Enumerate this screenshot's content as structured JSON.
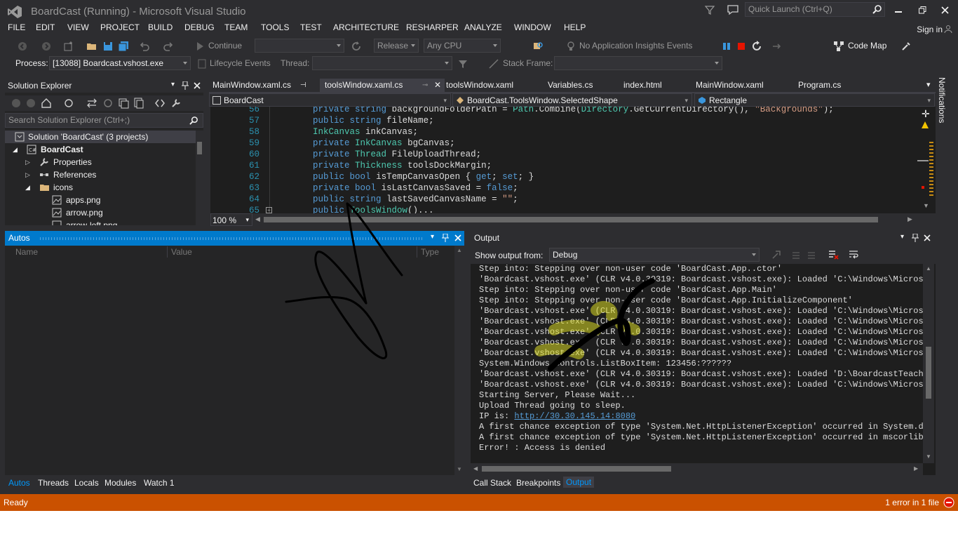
{
  "window": {
    "title": "BoardCast (Running) - Microsoft Visual Studio",
    "quick_launch": "Quick Launch (Ctrl+Q)",
    "sign_in": "Sign in"
  },
  "menu": [
    "FILE",
    "EDIT",
    "VIEW",
    "PROJECT",
    "BUILD",
    "DEBUG",
    "TEAM",
    "TOOLS",
    "TEST",
    "ARCHITECTURE",
    "RESHARPER",
    "ANALYZE",
    "WINDOW",
    "HELP"
  ],
  "toolbar": {
    "continue_label": "Continue",
    "config": "Release",
    "platform": "Any CPU",
    "insights": "No Application Insights Events",
    "code_map": "Code Map"
  },
  "debug_bar": {
    "process_label": "Process:",
    "process_value": "[13088] Boardcast.vshost.exe",
    "lifecycle": "Lifecycle Events",
    "thread_label": "Thread:",
    "stack_frame_label": "Stack Frame:"
  },
  "solution_explorer": {
    "title": "Solution Explorer",
    "search_placeholder": "Search Solution Explorer (Ctrl+;)",
    "items": [
      {
        "label": "Solution 'BoardCast' (3 projects)"
      },
      {
        "label": "BoardCast"
      },
      {
        "label": "Properties"
      },
      {
        "label": "References"
      },
      {
        "label": "icons"
      },
      {
        "label": "apps.png"
      },
      {
        "label": "arrow.png"
      },
      {
        "label": "arrow-left.png"
      }
    ]
  },
  "editor": {
    "tabs": [
      "MainWindow.xaml.cs",
      "toolsWindow.xaml.cs",
      "toolsWindow.xaml",
      "Variables.cs",
      "index.html",
      "MainWindow.xaml",
      "Program.cs"
    ],
    "active_tab": "toolsWindow.xaml.cs",
    "nav_project": "BoardCast",
    "nav_member": "BoardCast.ToolsWindow.SelectedShape",
    "nav_shape": "Rectangle",
    "zoom": "100 %",
    "lines": [
      {
        "n": "56",
        "code": "private string backgroundFolderPath = Path.Combine(Directory.GetCurrentDirectory(), \"Backgrounds\");"
      },
      {
        "n": "57",
        "code": "public string fileName;"
      },
      {
        "n": "58",
        "code": "InkCanvas inkCanvas;"
      },
      {
        "n": "59",
        "code": "private InkCanvas bgCanvas;"
      },
      {
        "n": "60",
        "code": "private Thread FileUploadThread;"
      },
      {
        "n": "61",
        "code": "private Thickness toolsDockMargin;"
      },
      {
        "n": "62",
        "code": "public bool isTempCanvasOpen { get; set; }"
      },
      {
        "n": "63",
        "code": "private bool isLastCanvasSaved = false;"
      },
      {
        "n": "64",
        "code": "public string lastSavedCanvasName = \"\";"
      },
      {
        "n": "65",
        "code": "public ToolsWindow()..."
      }
    ]
  },
  "autos": {
    "title": "Autos",
    "columns": [
      "Name",
      "Value",
      "Type"
    ],
    "tabs": [
      "Autos",
      "Threads",
      "Locals",
      "Modules",
      "Watch 1"
    ]
  },
  "output": {
    "title": "Output",
    "show_from_label": "Show output from:",
    "show_from_value": "Debug",
    "lines": [
      "Step into: Stepping over non-user code 'BoardCast.App..ctor'",
      "'Boardcast.vshost.exe' (CLR v4.0.30319: Boardcast.vshost.exe): Loaded 'C:\\Windows\\Microsoft",
      "Step into: Stepping over non-user code 'BoardCast.App.Main'",
      "Step into: Stepping over non-user code 'BoardCast.App.InitializeComponent'",
      "'Boardcast.vshost.exe' (CLR v4.0.30319: Boardcast.vshost.exe): Loaded 'C:\\Windows\\Microsoft",
      "'Boardcast.vshost.exe' (CLR v4.0.30319: Boardcast.vshost.exe): Loaded 'C:\\Windows\\Microsoft",
      "'Boardcast.vshost.exe' (CLR v4.0.30319: Boardcast.vshost.exe): Loaded 'C:\\Windows\\Microsoft",
      "'Boardcast.vshost.exe' (CLR v4.0.30319: Boardcast.vshost.exe): Loaded 'C:\\Windows\\Microsoft",
      "'Boardcast.vshost.exe' (CLR v4.0.30319: Boardcast.vshost.exe): Loaded 'C:\\Windows\\Microsoft",
      "System.Windows.Controls.ListBoxItem: 123456:??????",
      "'Boardcast.vshost.exe' (CLR v4.0.30319: Boardcast.vshost.exe): Loaded 'D:\\BoardcastTeacher\\",
      "'Boardcast.vshost.exe' (CLR v4.0.30319: Boardcast.vshost.exe): Loaded 'C:\\Windows\\Microsoft",
      "Starting Server, Please Wait...",
      "Upload Thread going to sleep.",
      "A first chance exception of type 'System.Net.HttpListenerException' occurred in System.dll",
      "A first chance exception of type 'System.Net.HttpListenerException' occurred in mscorlib.dl",
      "Error! : Access is denied"
    ],
    "ip_label": "IP is: ",
    "ip_link": "http://30.30.145.14:8080",
    "tabs": [
      "Call Stack",
      "Breakpoints",
      "Output"
    ]
  },
  "notifications_label": "Notifications",
  "status": {
    "left": "Ready",
    "right": "1 error in 1 file"
  },
  "colors": {
    "accent": "#007acc",
    "status_bar": "#ca5100",
    "background": "#2d2d30",
    "editor_bg": "#1e1e1e",
    "keyword": "#569cd6",
    "type": "#4ec9b0",
    "string": "#d69d85",
    "line_number": "#2b91af"
  }
}
